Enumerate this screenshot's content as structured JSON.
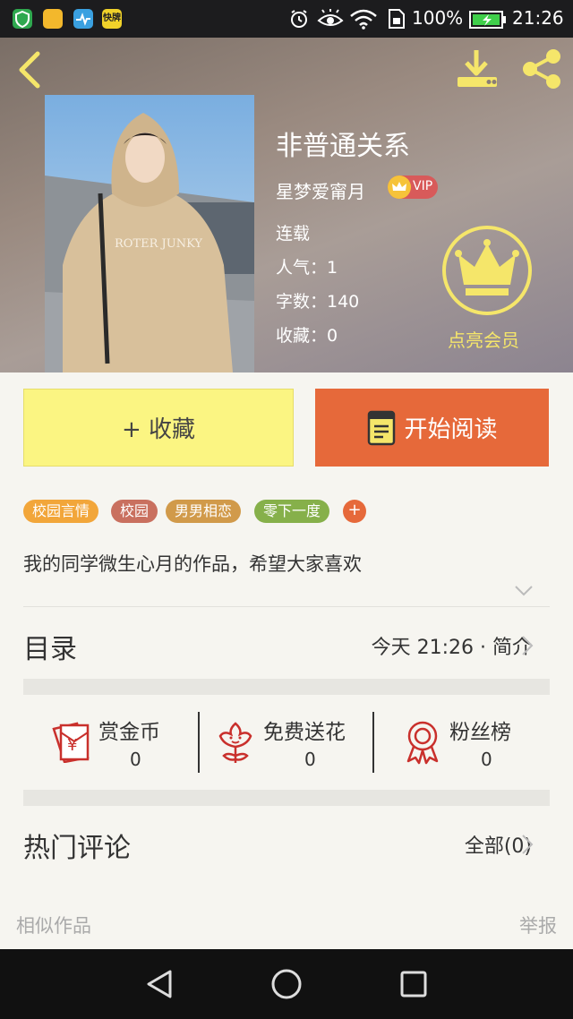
{
  "status_bar": {
    "battery_percent": "100%",
    "time": "21:26",
    "app_icon_colors": [
      "#2fa84f",
      "#f3b82c",
      "#3aa0e0",
      "#f0d22a"
    ],
    "app_badge_text": "快牌"
  },
  "header": {
    "book_title": "非普通关系",
    "author": "星梦爱甯月",
    "vip_badge": "VIP",
    "status": "连载",
    "popularity": "人气：1",
    "word_count": "字数：140",
    "favorites": "收藏：0",
    "member_label": "点亮会员",
    "cover_text": "ROTER JUNKY"
  },
  "actions": {
    "favorite_label": "+ 收藏",
    "read_label": "开始阅读"
  },
  "tags": [
    {
      "label": "校园言情",
      "color": "#f2a63a"
    },
    {
      "label": "校园",
      "color": "#c9705f"
    },
    {
      "label": "男男相恋",
      "color": "#d19a4a"
    },
    {
      "label": "零下一度",
      "color": "#86b04a"
    }
  ],
  "tag_more": "+",
  "description": "我的同学微生心月的作品，希望大家喜欢",
  "toc": {
    "title": "目录",
    "meta": "今天 21:26 · 简介"
  },
  "stats": [
    {
      "label": "赏金币",
      "value": "0",
      "icon": "gold-coin-envelope-icon"
    },
    {
      "label": "免费送花",
      "value": "0",
      "icon": "flower-icon"
    },
    {
      "label": "粉丝榜",
      "value": "0",
      "icon": "rosette-badge-icon"
    }
  ],
  "comments": {
    "title": "热门评论",
    "all_label": "全部(0)"
  },
  "footer": {
    "similar": "相似作品",
    "report": "举报"
  },
  "colors": {
    "accent_orange": "#e6693a",
    "accent_yellow": "#f5e66a",
    "fav_button_bg": "#fbf582",
    "icon_red": "#c9302c"
  }
}
